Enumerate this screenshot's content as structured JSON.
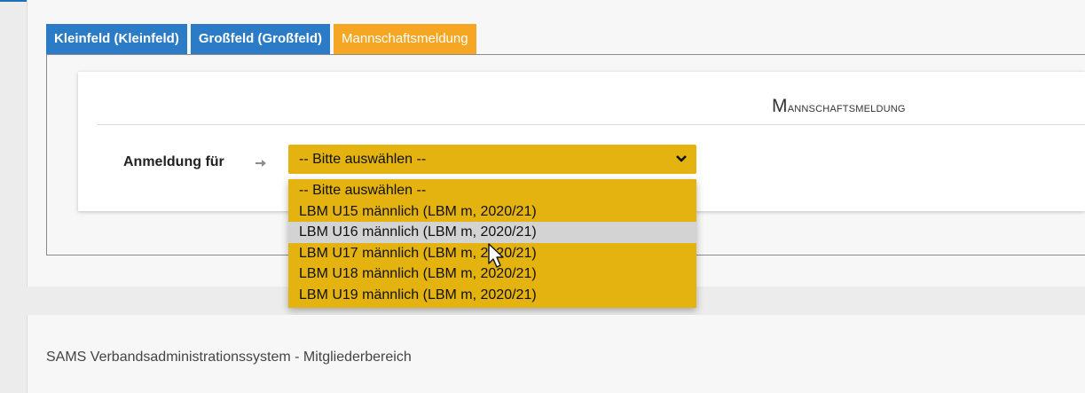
{
  "tabs": [
    {
      "label": "Kleinfeld (Kleinfeld)"
    },
    {
      "label": "Großfeld (Großfeld)"
    },
    {
      "label": "Mannschaftsmeldung"
    }
  ],
  "section": {
    "title_first": "M",
    "title_rest": "annschaftsmeldung"
  },
  "form": {
    "label": "Anmeldung für",
    "select_value": "-- Bitte auswählen --",
    "options": [
      {
        "label": "-- Bitte auswählen --"
      },
      {
        "label": "LBM U15 männlich (LBM m, 2020/21)"
      },
      {
        "label": "LBM U16 männlich (LBM m, 2020/21)"
      },
      {
        "label": "LBM U17 männlich (LBM m, 2020/21)"
      },
      {
        "label": "LBM U18 männlich (LBM m, 2020/21)"
      },
      {
        "label": "LBM U19 männlich (LBM m, 2020/21)"
      }
    ]
  },
  "footer": {
    "text": "SAMS Verbandsadministrationssystem - Mitgliederbereich"
  },
  "colors": {
    "tab_blue": "#2b7bc6",
    "tab_active": "#f5a623",
    "select_bg": "#e4b310",
    "hover": "#d3d3d3"
  },
  "icons": {
    "label_arrow": "arrow-right-icon",
    "select_toggle": "chevron-down-icon",
    "pointer": "mouse-cursor-icon"
  }
}
